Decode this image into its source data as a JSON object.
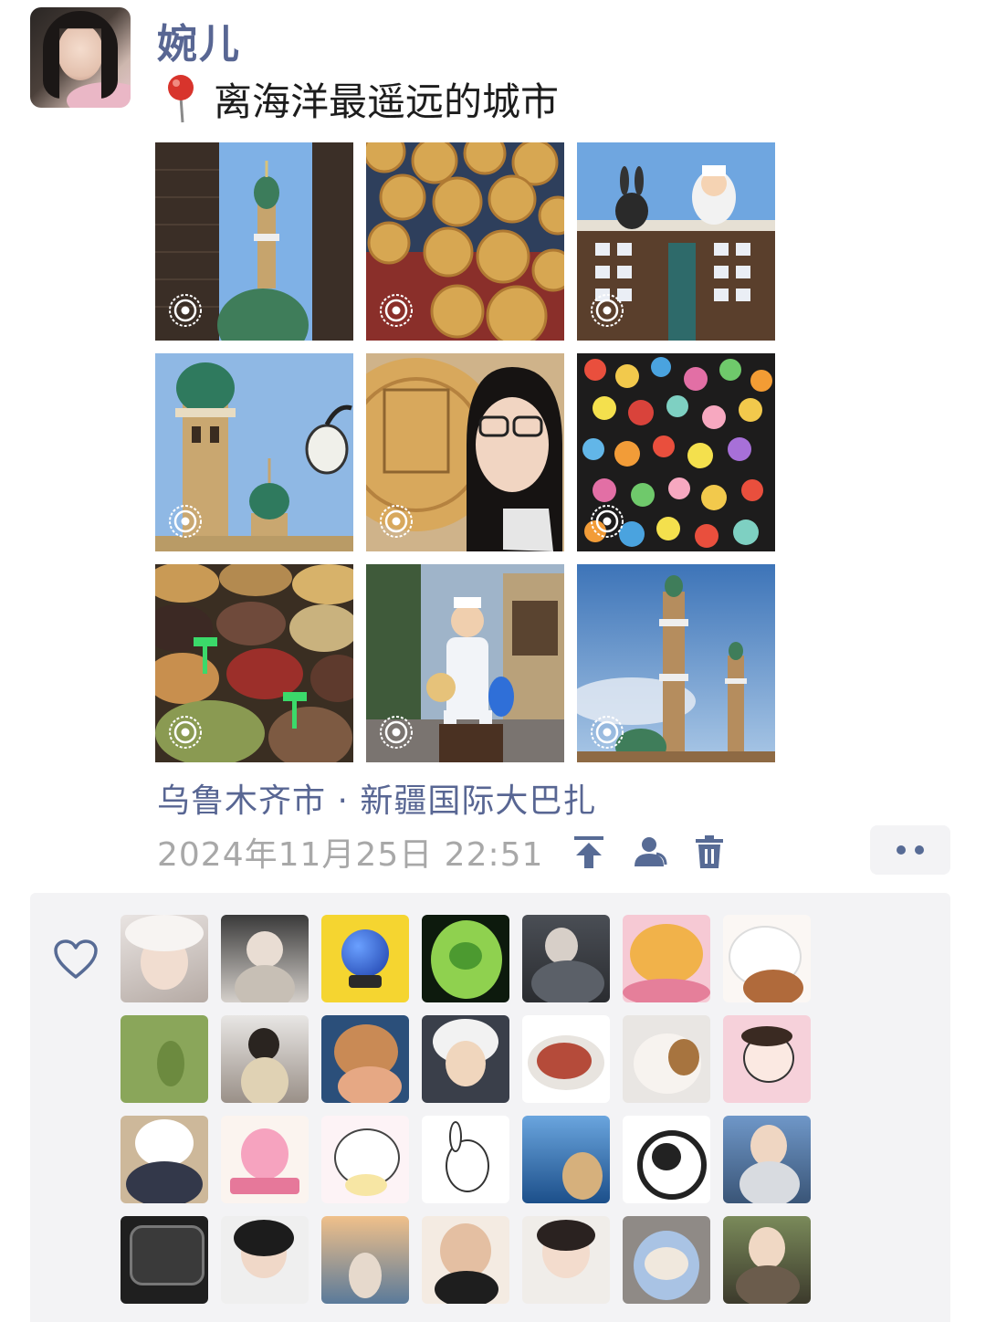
{
  "post": {
    "username": "婉儿",
    "caption": "离海洋最遥远的城市",
    "location": "乌鲁木齐市 · 新疆国际大巴扎",
    "timestamp": "2024年11月25日 22:51",
    "photos": [
      {
        "subject": "mosque-minaret",
        "live": true
      },
      {
        "subject": "flatbread-naan",
        "live": true
      },
      {
        "subject": "building-rooftop-statues",
        "live": true
      },
      {
        "subject": "green-domes",
        "live": true
      },
      {
        "subject": "selfie-with-mooncake",
        "live": true
      },
      {
        "subject": "fridge-magnets",
        "live": true
      },
      {
        "subject": "dried-fruit-market",
        "live": true
      },
      {
        "subject": "chef-statue",
        "live": true
      },
      {
        "subject": "minaret-towers",
        "live": true
      }
    ]
  },
  "icons": {
    "pin": "location-pin-icon",
    "live": "live-photo-icon",
    "pin_to_top": "pin-to-top-icon",
    "visibility": "visibility-icon",
    "delete": "trash-icon",
    "more": "more-icon",
    "like": "heart-icon"
  },
  "colors": {
    "name_blue": "#586693",
    "timestamp_gray": "#a8a8a8",
    "panel_bg": "#f3f3f5",
    "link_blue": "#576b95"
  },
  "likes": {
    "count": 28
  }
}
